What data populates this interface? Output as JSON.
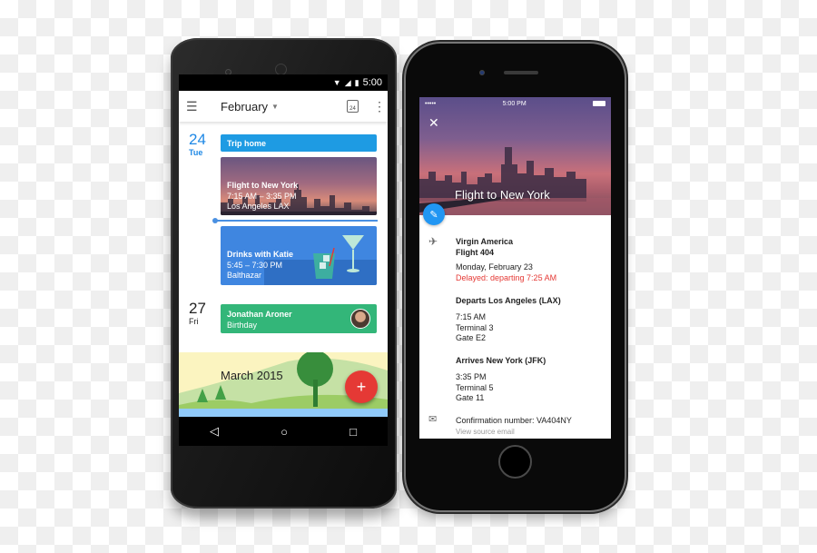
{
  "android": {
    "status": {
      "wifi_icon": "wifi-icon",
      "signal_icon": "signal-icon",
      "battery_icon": "battery-icon",
      "time": "5:00"
    },
    "toolbar": {
      "menu_icon": "menu-icon",
      "month": "February",
      "today_badge": "24",
      "more_icon": "more-vert-icon"
    },
    "days": [
      {
        "num": "24",
        "name": "Tue",
        "color": "#1e88e5"
      },
      {
        "num": "27",
        "name": "Fri",
        "color": "#222222"
      }
    ],
    "events": {
      "trip": {
        "title": "Trip home",
        "color": "#1e9be3"
      },
      "flight": {
        "title": "Flight to New York",
        "time": "7:15 AM – 3:35 PM",
        "location": "Los Angeles LAX"
      },
      "drinks": {
        "title": "Drinks with Katie",
        "time": "5:45 – 7:30 PM",
        "location": "Balthazar",
        "color": "#3f86e0"
      },
      "birthday": {
        "title": "Jonathan Aroner",
        "subtitle": "Birthday",
        "color": "#33b679"
      }
    },
    "month_banner": "March 2015",
    "fab_label": "+",
    "nav": {
      "back": "◁",
      "home": "○",
      "recents": "□"
    }
  },
  "iphone": {
    "status": {
      "signal": "•••••",
      "time": "5:00 PM"
    },
    "close_label": "✕",
    "title": "Flight to New York",
    "edit_label": "✎",
    "airline": "Virgin America",
    "flight": "Flight 404",
    "date": "Monday, February 23",
    "delay": "Delayed: departing 7:25 AM",
    "departs": {
      "heading": "Departs Los Angeles (LAX)",
      "time": "7:15 AM",
      "terminal": "Terminal 3",
      "gate": "Gate E2"
    },
    "arrives": {
      "heading": "Arrives New York (JFK)",
      "time": "3:35 PM",
      "terminal": "Terminal 5",
      "gate": "Gate 11"
    },
    "confirmation": "Confirmation number: VA404NY",
    "source_link": "View source email"
  }
}
